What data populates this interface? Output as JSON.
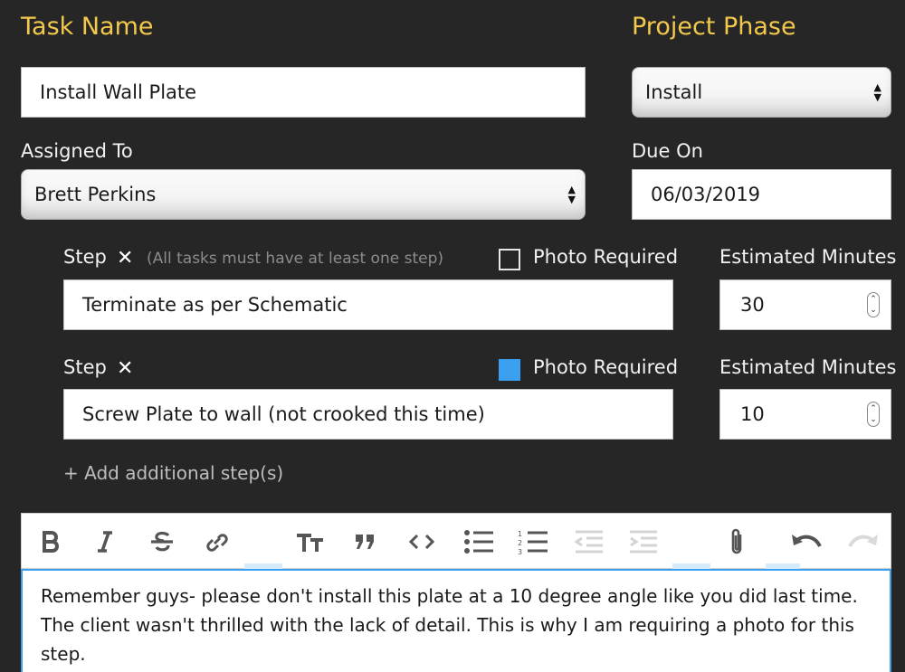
{
  "task": {
    "heading": "Task Name",
    "value": "Install Wall Plate"
  },
  "phase": {
    "heading": "Project Phase",
    "value": "Install"
  },
  "assigned": {
    "label": "Assigned To",
    "value": "Brett Perkins"
  },
  "due": {
    "label": "Due On",
    "value": "06/03/2019"
  },
  "steps": [
    {
      "label": "Step",
      "hint": "(All tasks must have at least one step)",
      "photo_label": "Photo Required",
      "photo_required": false,
      "minutes_label": "Estimated Minutes",
      "value": "Terminate as per Schematic",
      "minutes": "30"
    },
    {
      "label": "Step",
      "hint": "",
      "photo_label": "Photo Required",
      "photo_required": true,
      "minutes_label": "Estimated Minutes",
      "value": "Screw Plate to wall (not crooked this time)",
      "minutes": "10"
    }
  ],
  "add_step": "+ Add additional step(s)",
  "toolbar": {
    "buttons": [
      "bold-icon",
      "italic-icon",
      "strikethrough-icon",
      "link-icon",
      "text-size-icon",
      "quote-icon",
      "code-icon",
      "bullet-list-icon",
      "numbered-list-icon",
      "outdent-icon",
      "indent-icon",
      "attachment-icon",
      "undo-icon",
      "redo-icon"
    ]
  },
  "notes": "Remember guys- please don't install this plate at a 10 degree angle like you did last time. The client wasn't thrilled with the lack of detail. This is why I am requiring a photo for this step.",
  "colors": {
    "background": "#262626",
    "heading": "#f2c94c",
    "checkbox_checked": "#3ba0f0",
    "hint": "#8c8c8c"
  }
}
